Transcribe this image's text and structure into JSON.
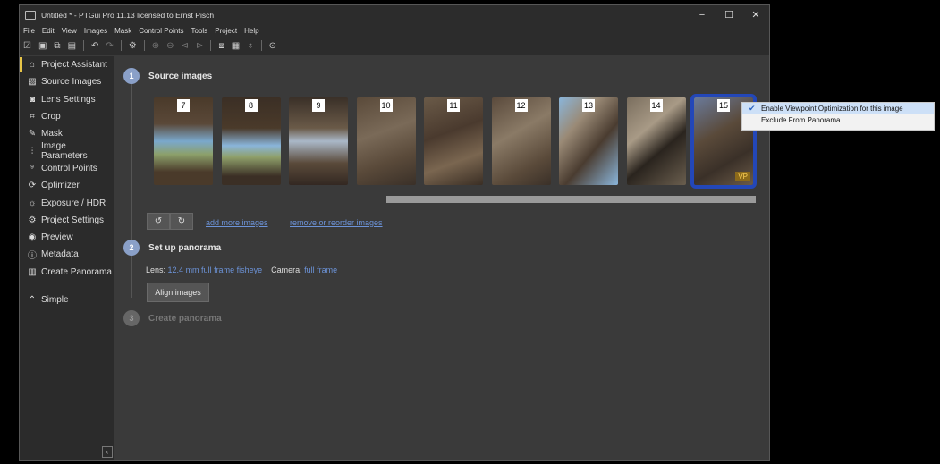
{
  "window": {
    "title": "Untitled * - PTGui Pro 11.13 licensed to Ernst Pisch",
    "minimize": "−",
    "maximize": "☐",
    "close": "✕"
  },
  "menu": [
    "File",
    "Edit",
    "View",
    "Images",
    "Mask",
    "Control Points",
    "Tools",
    "Project",
    "Help"
  ],
  "sidebar": {
    "items": [
      {
        "label": "Project Assistant",
        "icon": "home-icon",
        "glyph": "⌂"
      },
      {
        "label": "Source Images",
        "icon": "image-icon",
        "glyph": "▨"
      },
      {
        "label": "Lens Settings",
        "icon": "camera-icon",
        "glyph": "◙"
      },
      {
        "label": "Crop",
        "icon": "crop-icon",
        "glyph": "⌗"
      },
      {
        "label": "Mask",
        "icon": "brush-icon",
        "glyph": "✎"
      },
      {
        "label": "Image Parameters",
        "icon": "sliders-icon",
        "glyph": "⫶"
      },
      {
        "label": "Control Points",
        "icon": "points-icon",
        "glyph": "⁹"
      },
      {
        "label": "Optimizer",
        "icon": "optimizer-icon",
        "glyph": "⟳"
      },
      {
        "label": "Exposure / HDR",
        "icon": "sun-icon",
        "glyph": "☼"
      },
      {
        "label": "Project Settings",
        "icon": "gear-icon",
        "glyph": "⚙"
      },
      {
        "label": "Preview",
        "icon": "eye-icon",
        "glyph": "◉"
      },
      {
        "label": "Metadata",
        "icon": "info-icon",
        "glyph": "ⓘ"
      },
      {
        "label": "Create Panorama",
        "icon": "panorama-icon",
        "glyph": "▥"
      }
    ],
    "simple": {
      "label": "Simple",
      "glyph": "⌃"
    }
  },
  "steps": {
    "s1": {
      "num": "1",
      "title": "Source images"
    },
    "s2": {
      "num": "2",
      "title": "Set up panorama"
    },
    "s3": {
      "num": "3",
      "title": "Create panorama"
    }
  },
  "thumbnails": [
    "7",
    "8",
    "9",
    "10",
    "11",
    "12",
    "13",
    "14",
    "15"
  ],
  "vp_badge": "VP",
  "links": {
    "add": "add more images",
    "remove": "remove or reorder images"
  },
  "lens": {
    "label": "Lens:",
    "value": "12.4 mm full frame fisheye",
    "camera_label": "Camera:",
    "camera_value": "full frame"
  },
  "align_button": "Align images",
  "context_menu": {
    "enable_vp": "Enable Viewpoint Optimization for this image",
    "exclude": "Exclude From Panorama"
  },
  "colors": {
    "accent": "#e8c547",
    "selection": "#2347b8",
    "link": "#6c93d8"
  }
}
